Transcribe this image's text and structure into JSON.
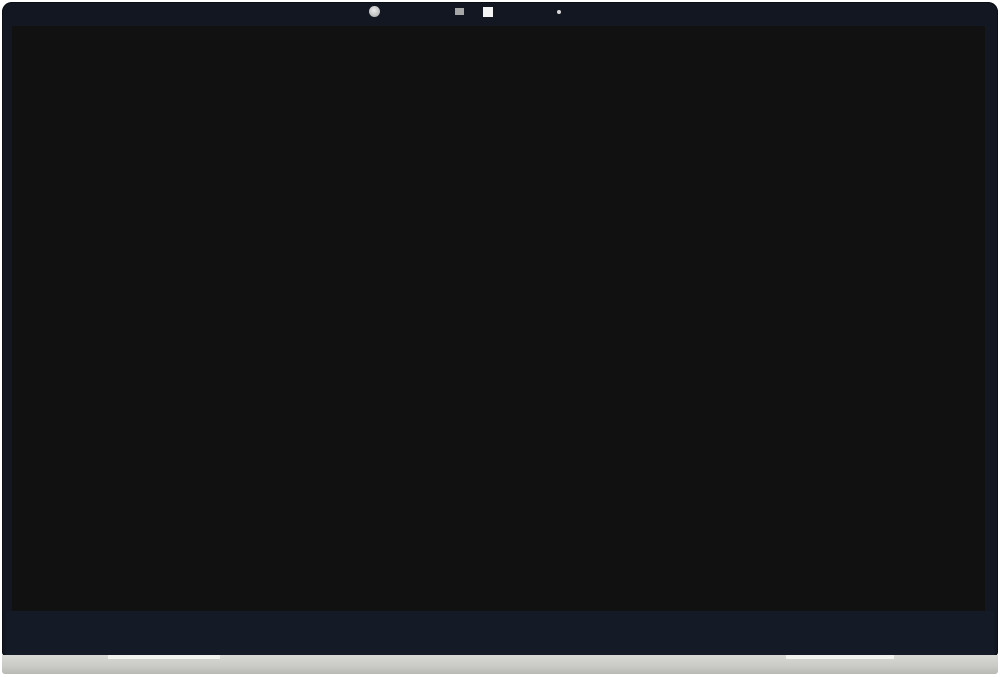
{
  "device": {
    "type": "laptop display assembly (powered off)",
    "colors": {
      "screen": "#111111",
      "bezel": "#121722",
      "hinge": "#c9c9c5"
    }
  },
  "icons": {
    "camera": "webcam-icon",
    "ir_sensor": "ir-sensor-icon",
    "ir_emitter": "ir-emitter-icon",
    "indicator": "indicator-light-icon"
  }
}
